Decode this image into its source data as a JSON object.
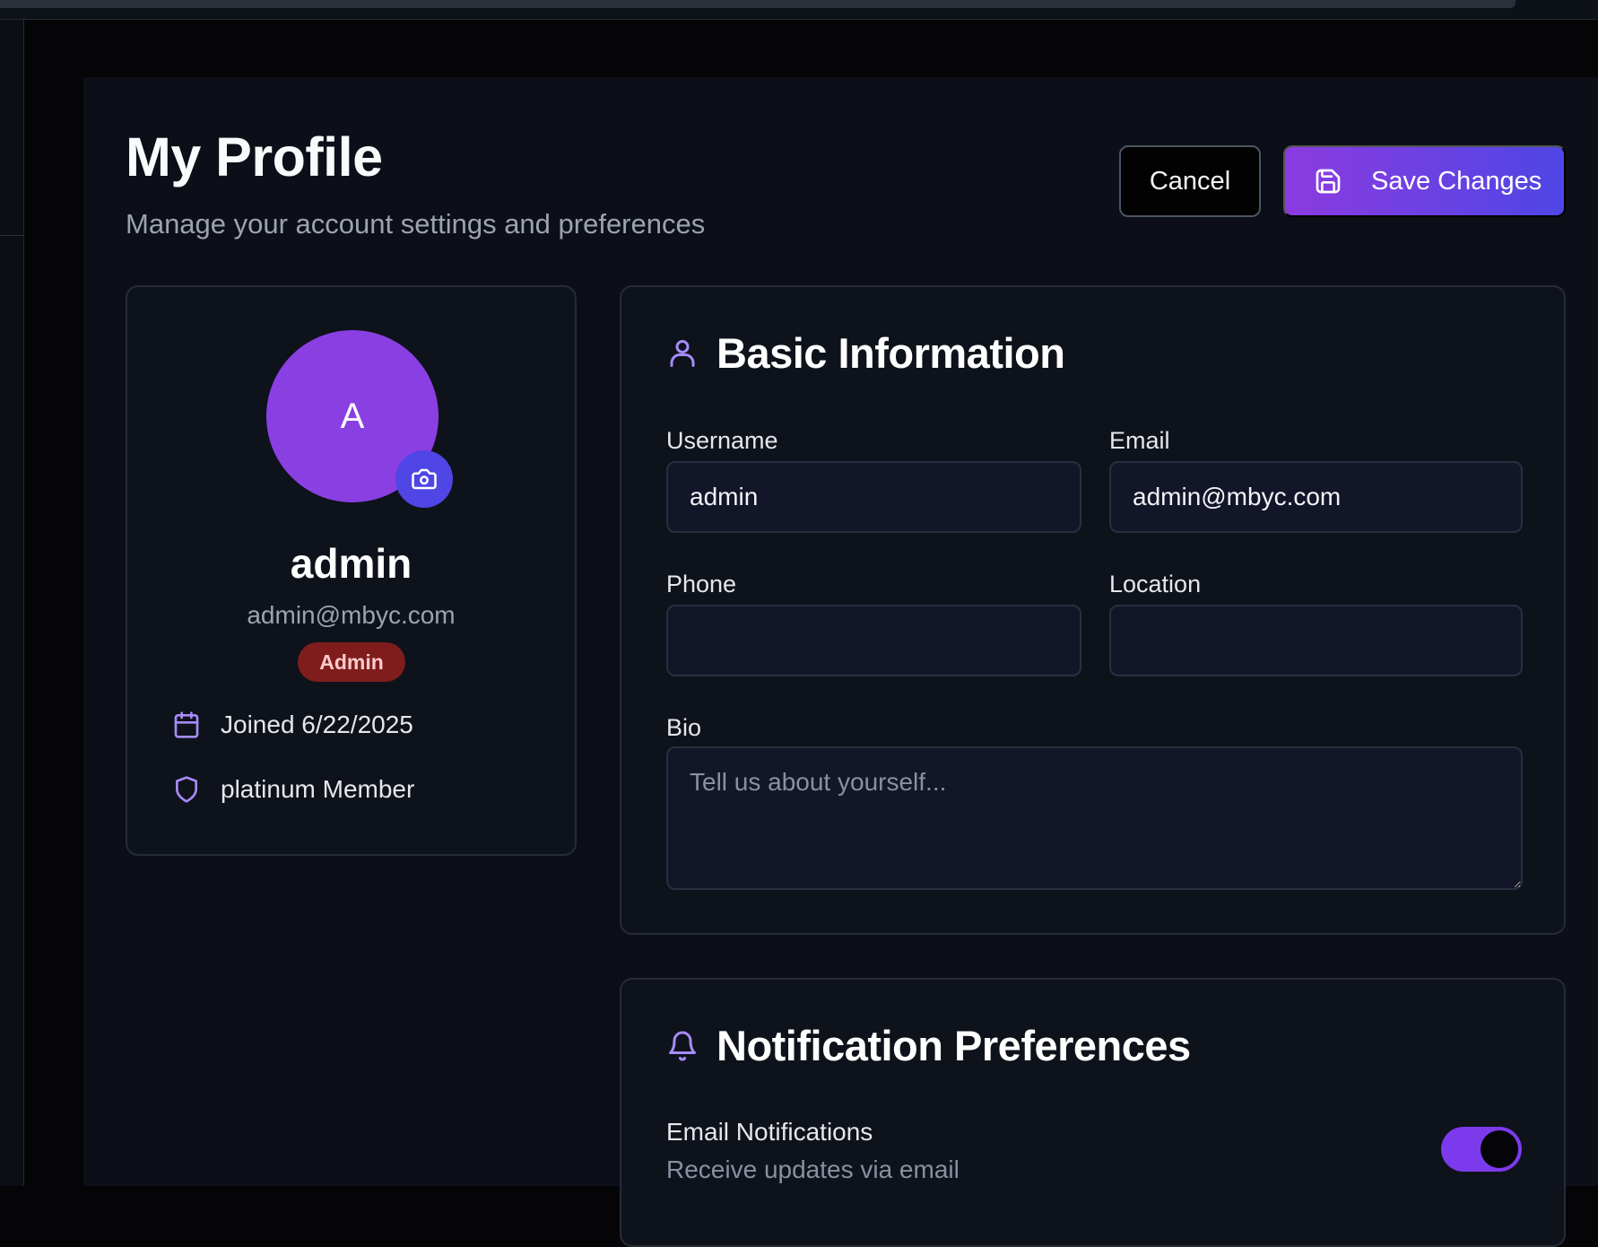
{
  "colors": {
    "accent": "#8a3fe3",
    "accent_gradient_end": "#4f46e5",
    "badge_bg": "#7f1d1d",
    "icon_purple": "#a78bfa"
  },
  "header": {
    "title": "My Profile",
    "subtitle": "Manage your account settings and preferences"
  },
  "actions": {
    "cancel_label": "Cancel",
    "save_label": "Save Changes",
    "save_icon": "save-icon"
  },
  "profile": {
    "avatar_initial": "A",
    "camera_icon": "camera-icon",
    "name": "admin",
    "email": "admin@mbyc.com",
    "role_badge": "Admin",
    "joined_text": "Joined 6/22/2025",
    "joined_icon": "calendar-icon",
    "membership_text": "platinum Member",
    "membership_icon": "shield-icon"
  },
  "basic_info": {
    "title": "Basic Information",
    "icon": "user-icon",
    "username_label": "Username",
    "username_value": "admin",
    "email_label": "Email",
    "email_value": "admin@mbyc.com",
    "phone_label": "Phone",
    "phone_value": "",
    "location_label": "Location",
    "location_value": "",
    "bio_label": "Bio",
    "bio_placeholder": "Tell us about yourself...",
    "bio_value": ""
  },
  "notifications": {
    "title": "Notification Preferences",
    "icon": "bell-icon",
    "email_notifications_label": "Email Notifications",
    "email_notifications_desc": "Receive updates via email",
    "email_notifications_enabled": true
  }
}
